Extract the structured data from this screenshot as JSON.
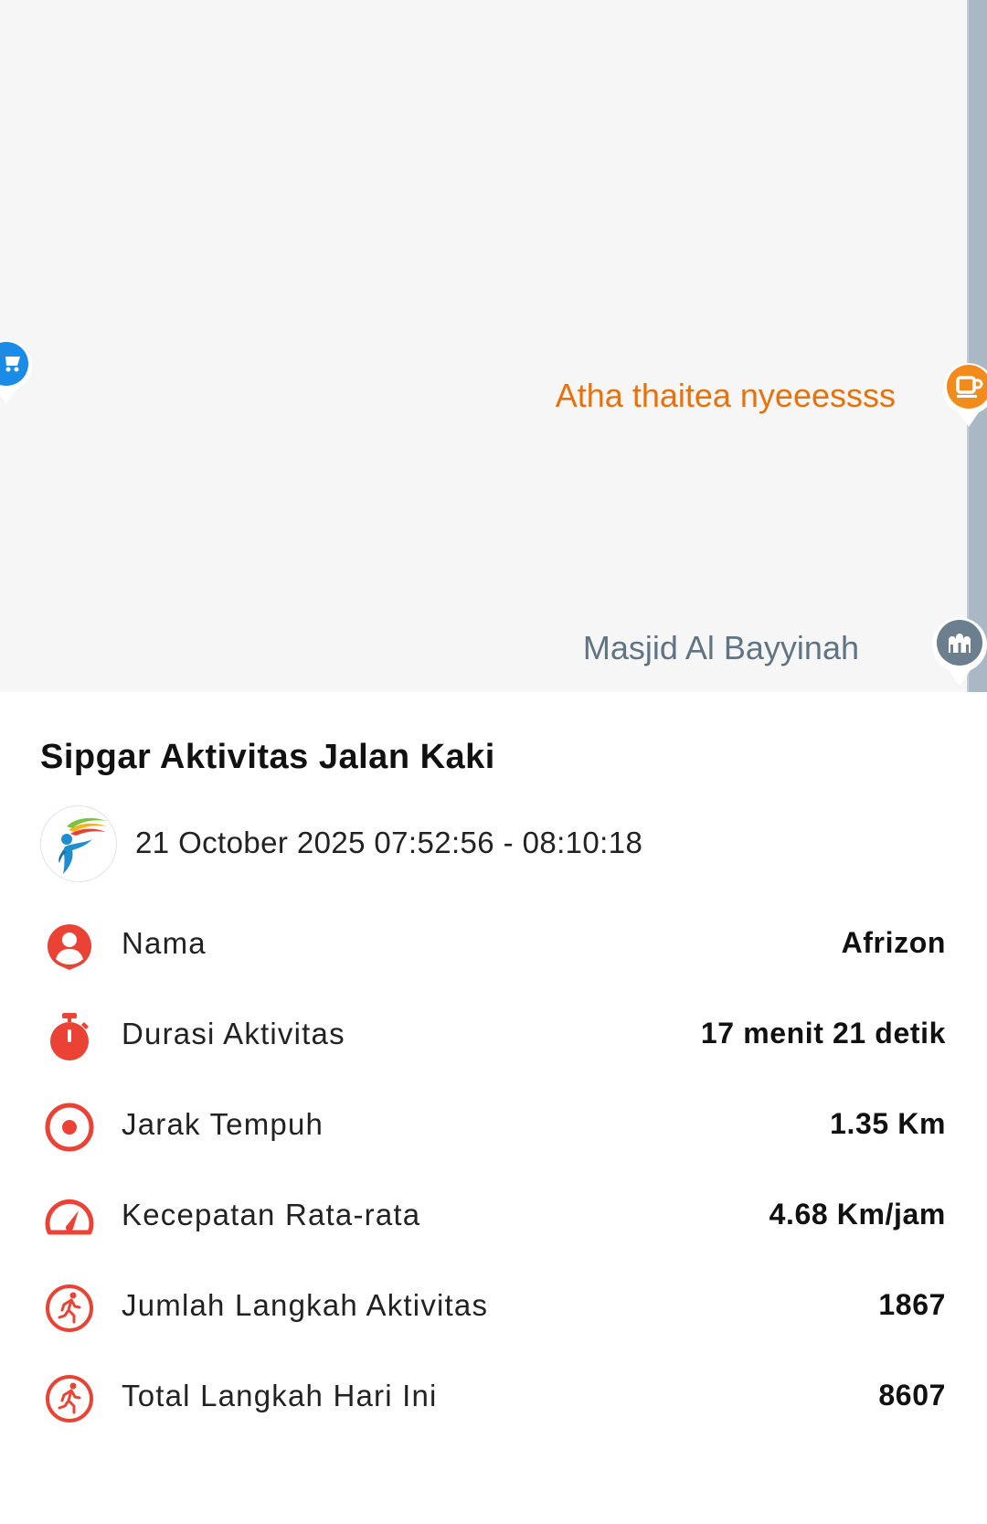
{
  "map": {
    "pois": {
      "cafe": {
        "label": "Atha thaitea nyeeessss",
        "icon": "cafe-icon",
        "color": "#e8710a"
      },
      "mosque": {
        "label": "Masjid Al Bayyinah",
        "icon": "mosque-icon",
        "color": "#5f7484"
      },
      "shop": {
        "icon": "shopping-cart-icon",
        "color": "#1a8ce8"
      }
    }
  },
  "sheet": {
    "title": "Sipgar Aktivitas Jalan Kaki",
    "logo_icon": "sipgar-logo",
    "datetime": "21 October 2025 07:52:56 - 08:10:18",
    "accent_color": "#ea4335",
    "stats": [
      {
        "icon": "person-pin-icon",
        "label": "Nama",
        "value": "Afrizon"
      },
      {
        "icon": "stopwatch-icon",
        "label": "Durasi Aktivitas",
        "value": "17 menit 21 detik"
      },
      {
        "icon": "target-icon",
        "label": "Jarak Tempuh",
        "value": "1.35 Km"
      },
      {
        "icon": "speedometer-icon",
        "label": "Kecepatan Rata-rata",
        "value": "4.68 Km/jam"
      },
      {
        "icon": "running-icon",
        "label": "Jumlah Langkah Aktivitas",
        "value": "1867"
      },
      {
        "icon": "running-icon",
        "label": "Total Langkah Hari Ini",
        "value": "8607"
      }
    ]
  }
}
